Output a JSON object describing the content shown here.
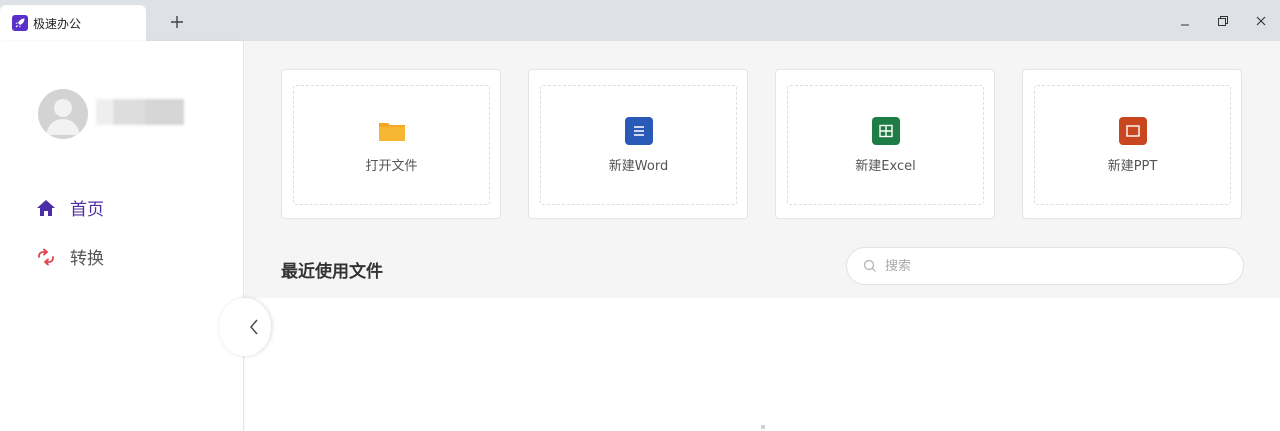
{
  "tab": {
    "title": "极速办公"
  },
  "new_tab_label": "+",
  "sidebar": {
    "nav": [
      {
        "label": "首页",
        "icon": "home-icon",
        "active": true
      },
      {
        "label": "转换",
        "icon": "convert-icon",
        "active": false
      }
    ]
  },
  "cards": [
    {
      "label": "打开文件",
      "icon": "folder-icon",
      "color": "#f5a623"
    },
    {
      "label": "新建Word",
      "icon": "word-doc-icon",
      "color": "#2a5ab8"
    },
    {
      "label": "新建Excel",
      "icon": "excel-sheet-icon",
      "color": "#1e7d45"
    },
    {
      "label": "新建PPT",
      "icon": "ppt-slide-icon",
      "color": "#c8471f"
    }
  ],
  "recent": {
    "title": "最近使用文件"
  },
  "search": {
    "placeholder": "搜索",
    "value": ""
  },
  "colors": {
    "accent": "#4b2ea5",
    "titlebar": "#dee1e6",
    "main_bg": "#f5f5f5"
  }
}
